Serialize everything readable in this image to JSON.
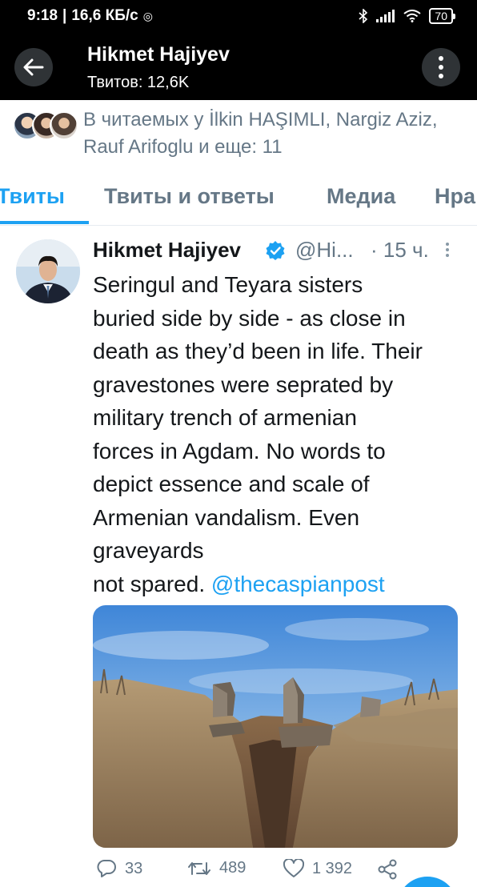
{
  "status_bar": {
    "time": "9:18",
    "net_speed": "16,6 КБ/с",
    "battery": "70"
  },
  "header": {
    "title": "Hikmet Hajiyev",
    "subtitle": "Твитов: 12,6K"
  },
  "followers": {
    "text": "В читаемых у İlkin HAŞIMLI, Nargiz Aziz, Rauf Arifoglu и еще: 11"
  },
  "tabs": [
    {
      "label": "Твиты",
      "active": true
    },
    {
      "label": "Твиты и ответы",
      "active": false
    },
    {
      "label": "Медиа",
      "active": false
    },
    {
      "label": "Нра",
      "active": false
    }
  ],
  "tweet": {
    "author_name": "Hikmet Hajiyev",
    "handle": "@Hi...",
    "time": "· 15 ч.",
    "text_lines": [
      "Seringul and Teyara sisters",
      "buried side by side - as close in",
      "death as they’d been in life. Their",
      "gravestones were seprated by",
      "military trench of armenian",
      "forces in Agdam. No words to",
      "depict essence and scale of",
      "Armenian vandalism. Even",
      "graveyards",
      "not spared."
    ],
    "mention": "@thecaspianpost",
    "replies": "33",
    "retweets": "489",
    "likes": "1 392"
  },
  "colors": {
    "accent": "#1da1f2",
    "secondary_text": "#657786",
    "header_bg": "#000000"
  },
  "icons": [
    "back-arrow-icon",
    "more-vertical-icon",
    "verified-badge-icon",
    "caret-down-icon",
    "reply-icon",
    "retweet-icon",
    "like-icon",
    "share-icon"
  ]
}
